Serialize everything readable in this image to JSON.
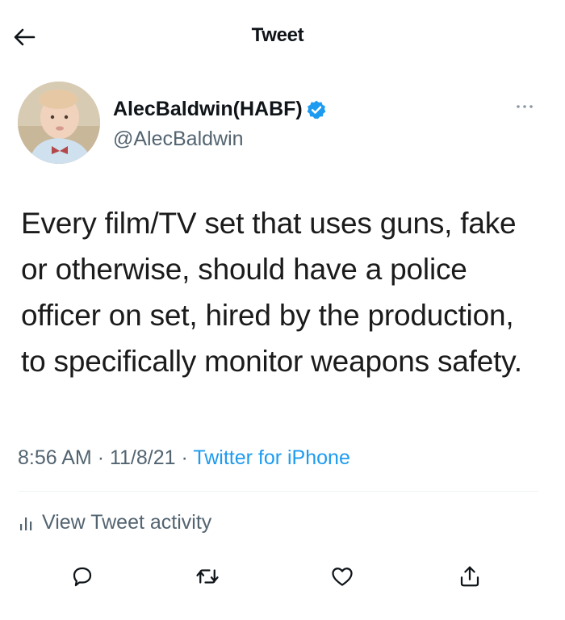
{
  "header": {
    "title": "Tweet",
    "back_icon": "arrow-left-icon"
  },
  "author": {
    "display_name": "AlecBaldwin(HABF)",
    "handle": "@AlecBaldwin",
    "verified": true,
    "verified_color": "#1d9bf0"
  },
  "tweet": {
    "text": "Every film/TV set that uses guns, fake or otherwise, should have a police officer on set, hired by the production, to specifically monitor weapons safety.",
    "time": "8:56 AM",
    "date": "11/8/21",
    "separator": "·",
    "source": "Twitter for iPhone"
  },
  "activity": {
    "label": "View Tweet activity",
    "icon": "bar-chart-icon"
  },
  "actions": [
    {
      "name": "reply",
      "icon": "reply-icon"
    },
    {
      "name": "retweet",
      "icon": "retweet-icon"
    },
    {
      "name": "like",
      "icon": "heart-icon"
    },
    {
      "name": "share",
      "icon": "share-icon"
    }
  ],
  "colors": {
    "text_primary": "#0f1419",
    "text_secondary": "#536471",
    "link": "#1d9bf0"
  }
}
